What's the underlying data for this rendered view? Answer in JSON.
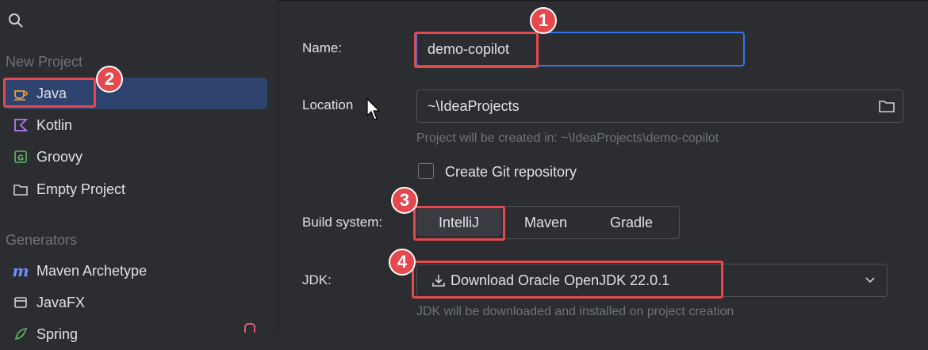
{
  "sidebar": {
    "new_project_label": "New Project",
    "items": [
      {
        "label": "Java",
        "icon": "java-cup-icon"
      },
      {
        "label": "Kotlin",
        "icon": "kotlin-icon"
      },
      {
        "label": "Groovy",
        "icon": "groovy-icon"
      },
      {
        "label": "Empty Project",
        "icon": "folder-icon"
      }
    ],
    "generators_label": "Generators",
    "generators": [
      {
        "label": "Maven Archetype",
        "icon": "maven-icon"
      },
      {
        "label": "JavaFX",
        "icon": "window-icon"
      },
      {
        "label": "Spring",
        "icon": "spring-icon"
      }
    ]
  },
  "form": {
    "name_label": "Name:",
    "name_value": "demo-copilot",
    "location_label": "Location",
    "location_value": "~\\IdeaProjects",
    "location_hint": "Project will be created in: ~\\IdeaProjects\\demo-copilot",
    "git_label": "Create Git repository",
    "build_label": "Build system:",
    "build_options": [
      "IntelliJ",
      "Maven",
      "Gradle"
    ],
    "jdk_label": "JDK:",
    "jdk_value": "Download Oracle OpenJDK 22.0.1",
    "jdk_hint": "JDK will be downloaded and installed on project creation"
  },
  "callouts": [
    "1",
    "2",
    "3",
    "4"
  ],
  "colors": {
    "accent": "#3574f0",
    "callout": "#e5484d",
    "selected": "#2e436e",
    "background": "#2b2d30"
  }
}
